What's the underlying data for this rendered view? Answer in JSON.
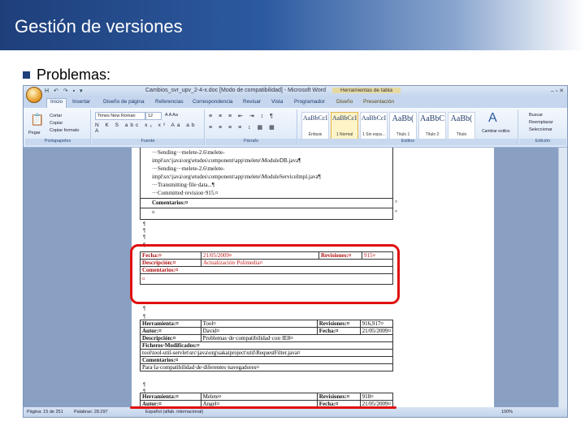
{
  "slide": {
    "title": "Gestión de versiones",
    "bullet": "Problemas:"
  },
  "word": {
    "window_title": "Cambios_svr_upv_2-4-x.doc [Modo de compatibilidad] - Microsoft Word",
    "context_title": "Herramientas de tabla",
    "qat": "H ↶ ↷ ▪ ▾",
    "window_controls": "– ▫ ✕",
    "tabs": [
      "Inicio",
      "Insertar",
      "Diseño de página",
      "Referencias",
      "Correspondencia",
      "Revisar",
      "Vista",
      "Programador",
      "Diseño",
      "Presentación"
    ],
    "clipboard": {
      "paste": "Pegar",
      "cut": "Cortar",
      "copy": "Copiar",
      "format": "Copiar formato",
      "label": "Portapapeles"
    },
    "font": {
      "family": "Times New Roman",
      "size": "12",
      "row1": "A A Aa",
      "row2": "N K S abc x₂ x² Aa ab A",
      "label": "Fuente"
    },
    "paragraph": {
      "row1": "≡ ≡ ≡ ⇤ ⇥ ↕ ¶",
      "row2": "≡ ≡ ≡ ≡ ↕ ▦ ▦",
      "label": "Párrafo"
    },
    "styles": [
      {
        "preview": "AaBbCcI",
        "name": "Énfasis"
      },
      {
        "preview": "AaBbCcI",
        "name": "1 Normal"
      },
      {
        "preview": "AaBbCcI",
        "name": "1 Sin espa..."
      },
      {
        "preview": "AaBb(",
        "name": "Título 1"
      },
      {
        "preview": "AaBbC",
        "name": "Título 2"
      },
      {
        "preview": "AaBb(",
        "name": "Título"
      }
    ],
    "styles_label": "Estilos",
    "change_styles": "Cambiar estilos",
    "editing": {
      "find": "Buscar",
      "replace": "Reemplazar",
      "select": "Seleccionar",
      "label": "Edición"
    },
    "status": {
      "page": "Página: 15 de 251",
      "words": "Palabras: 28.297",
      "lang": "Español (alfab. internacional)",
      "zoom": "100%"
    }
  },
  "document": {
    "svn_lines": [
      "···Sending···melete-2.6\\melete-",
      "impl\\src\\java\\org\\etudes\\component\\app\\melete\\ModuleDB.java¶",
      "···Sending···melete-2.6\\melete-",
      "impl\\src\\java\\org\\etudes\\component\\app\\melete\\ModuleServiceImpl.java¶",
      "···Transmitting·file·data...¶",
      "···Committed·revision·915.¤"
    ],
    "comentarios_label": "Comentarios:¤",
    "comentarios_mark": "¤",
    "pilcrow": "¶",
    "cell_mark": "¤",
    "red_table": {
      "fecha_label": "Fecha:¤",
      "fecha_value": "21/05/2009¤",
      "revisiones_label": "Revisiones:¤",
      "revisiones_value": "915¤",
      "descripcion_label": "Descripción:¤",
      "descripcion_value": "Actualización·Polimedia¤",
      "comentarios_label": "Comentarios:¤",
      "comentarios_value": "¤"
    },
    "table2": {
      "herramienta_label": "Herramienta:¤",
      "herramienta_value": "Tool¤",
      "revisiones_label": "Revisiones:¤",
      "revisiones_value": "916,917¤",
      "autor_label": "Autor:¤",
      "autor_value": "David¤",
      "fecha_label": "Fecha:¤",
      "fecha_value": "21/05/2009¤",
      "descripcion_label": "Descripción:¤",
      "descripcion_value": "Problemas·de·compatibilidad·con·IE8¤",
      "ficheros_label": "Ficheros·Modificados:¤",
      "ficheros_value": "tool\\tool-util-servlet\\src\\java\\org\\sakaiproject\\util\\RequestFilter.java¤",
      "comentarios_label": "Comentarios:¤",
      "comentarios_value": "Para·la·compatibilidad·de·diferentes·navegadores¤"
    },
    "table3": {
      "herramienta_label": "Herramienta:¤",
      "herramienta_value": "Melete¤",
      "revisiones_label": "Revisiones:¤",
      "revisiones_value": "918¤",
      "autor_label": "Autor:¤",
      "autor_value": "Angel¤",
      "fecha_label": "Fecha:¤",
      "fecha_value": "21/05/2009¤"
    }
  },
  "colors": {
    "header_dark": "#1e3f7a",
    "highlight": "#e01010",
    "red_text": "#c01818"
  }
}
